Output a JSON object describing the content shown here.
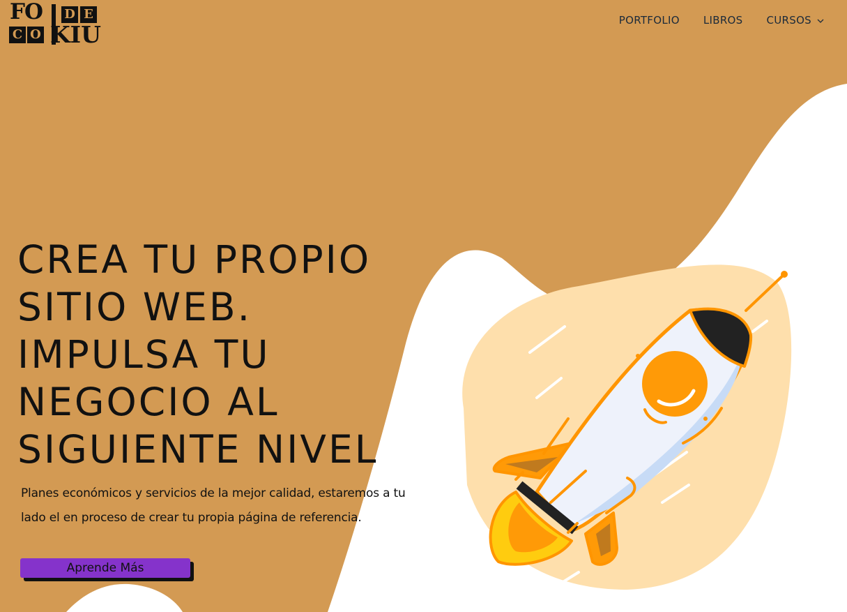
{
  "logo": {
    "text_top": "FO",
    "box_d": "D",
    "box_e": "E",
    "box_c": "C",
    "box_o": "O",
    "text_bottom": "KIU"
  },
  "nav": {
    "items": [
      {
        "label": "PORTFOLIO"
      },
      {
        "label": "LIBROS"
      },
      {
        "label": "CURSOS",
        "icon": "chevron-down-icon"
      }
    ]
  },
  "hero": {
    "title_lines": [
      "CREA TU PROPIO",
      "SITIO WEB.",
      "IMPULSA TU",
      "NEGOCIO AL",
      "SIGUIENTE NIVEL"
    ],
    "subtitle": "Planes económicos y servicios de la mejor calidad, estaremos a tu lado el en proceso de crear tu propia página de referencia.",
    "cta_label": "Aprende Más",
    "illustration": "rocket-illustration"
  },
  "colors": {
    "background": "#d39a53",
    "wave": "#ffffff",
    "blob": "#fedfac",
    "cta": "#8533cb",
    "text": "#111111",
    "nav_text": "#1b2a3a"
  }
}
